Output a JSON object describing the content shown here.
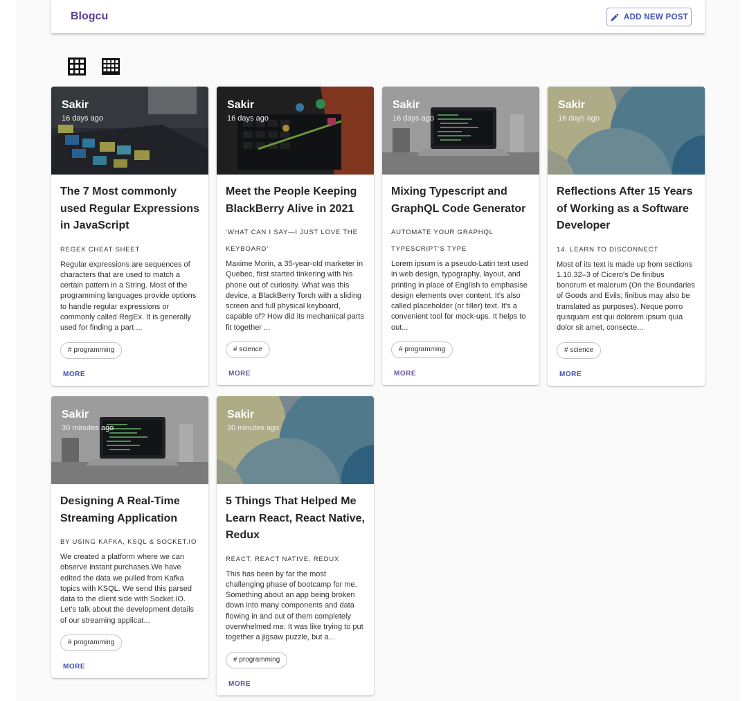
{
  "header": {
    "brand": "Blogcu",
    "add_post_label": "ADD NEW POST"
  },
  "colors": {
    "brand": "#5b3f8f",
    "accent": "#3f51b5",
    "more_link": "#6a4ea0"
  },
  "view_toggles": [
    {
      "icon": "grid-3x3-icon"
    },
    {
      "icon": "grid-4x3-icon"
    }
  ],
  "cards": [
    {
      "author": "Sakir",
      "time": "16 days ago",
      "image": "sticky-notes-desk",
      "title": "The 7 Most commonly used Regular Expressions in JavaScript",
      "subtitle": "Regex Cheat Sheet",
      "excerpt": "Regular expressions are sequences of characters that are used to match a certain pattern in a String. Most of the programming languages provide options to handle regular expressions or commonly called RegEx. It is generally used for finding a part ...",
      "tag": "# programming",
      "more": "MORE"
    },
    {
      "author": "Sakir",
      "time": "16 days ago",
      "image": "keyboard-toys",
      "title": "Meet the People Keeping BlackBerry Alive in 2021",
      "subtitle": "‘What can I say—I just love the keyboard’",
      "excerpt": "Maxime Morin, a 35-year-old marketer in Quebec, first started tinkering with his phone out of curiosity. What was this device, a BlackBerry Torch with a sliding screen and full physical keyboard, capable of? How did its mechanical parts fit together ...",
      "tag": "# science",
      "more": "MORE"
    },
    {
      "author": "Sakir",
      "time": "16 days ago",
      "image": "laptop-code",
      "title": "Mixing Typescript and GraphQL Code Generator",
      "subtitle": "Automate your GraphQL TypeScript’s type",
      "excerpt": "Lorem ipsum is a pseudo-Latin text used in web design, typography, layout, and printing in place of English to emphasise design elements over content. It's also called placeholder (or filler) text. It's a convenient tool for mock-ups. It helps to out...",
      "tag": "# programming",
      "more": "MORE"
    },
    {
      "author": "Sakir",
      "time": "16 days ago",
      "image": "abstract-circles",
      "title": "Reflections After 15 Years of Working as a Software Developer",
      "subtitle": "14. Learn to disconnect",
      "excerpt": "Most of its text is made up from sections 1.10.32–3 of Cicero's De finibus bonorum et malorum (On the Boundaries of Goods and Evils; finibus may also be translated as purposes). Neque porro quisquam est qui dolorem ipsum quia dolor sit amet, consecte...",
      "tag": "# science",
      "more": "MORE"
    },
    {
      "author": "Sakir",
      "time": "30 minutes ago",
      "image": "laptop-code",
      "title": "Designing A Real-Time Streaming Application",
      "subtitle": "By using Kafka, KSQL & Socket.io",
      "excerpt": "We created a platform where we can observe instant purchases.We have edited the data we pulled from Kafka topics with KSQL. We send this parsed data to the client side with Socket.IO. Let’s talk about the development details of our streaming applicat...",
      "tag": "# programming",
      "more": "MORE"
    },
    {
      "author": "Sakir",
      "time": "30 minutes ago",
      "image": "abstract-circles",
      "title": "5 Things That Helped Me Learn React, React Native, Redux",
      "subtitle": "React, React Native, Redux",
      "excerpt": "This has been by far the most challenging phase of bootcamp for me. Something about an app being broken down into many components and data flowing in and out of them completely overwhelmed me. It was like trying to put together a jigsaw puzzle, but a...",
      "tag": "# programming",
      "more": "MORE"
    }
  ]
}
